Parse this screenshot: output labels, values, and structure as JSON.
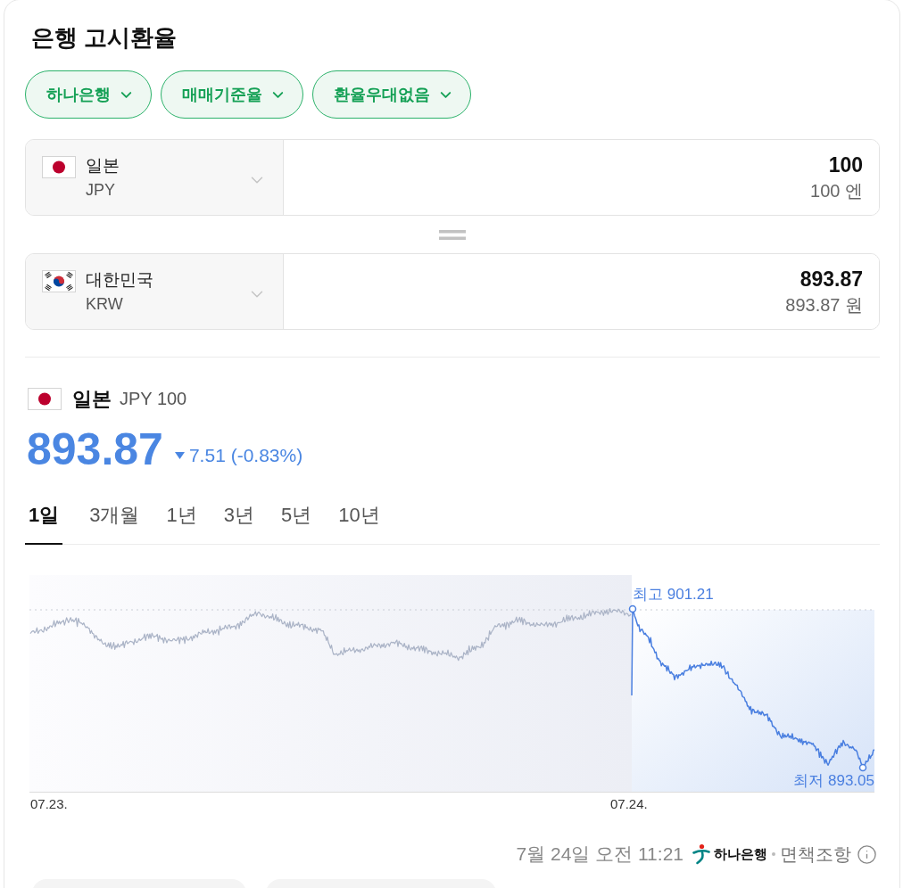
{
  "title": "은행 고시환율",
  "filters": [
    {
      "label": "하나은행"
    },
    {
      "label": "매매기준율"
    },
    {
      "label": "환율우대없음"
    }
  ],
  "converter": {
    "rows": [
      {
        "kind": "jp",
        "country": "일본",
        "code": "JPY",
        "amount": "100",
        "amount_text": "100 엔"
      },
      {
        "kind": "kr",
        "country": "대한민국",
        "code": "KRW",
        "amount": "893.87",
        "amount_text": "893.87 원"
      }
    ]
  },
  "quote": {
    "country": "일본",
    "unit": "JPY 100",
    "price": "893.87",
    "falling": true,
    "change": "7.51 (-0.83%)"
  },
  "periods": [
    {
      "label": "1일",
      "selected": true
    },
    {
      "label": "3개월",
      "selected": false
    },
    {
      "label": "1년",
      "selected": false
    },
    {
      "label": "3년",
      "selected": false
    },
    {
      "label": "5년",
      "selected": false
    },
    {
      "label": "10년",
      "selected": false
    }
  ],
  "chart": {
    "high_label": "최고 901.21",
    "low_label": "최저 893.05",
    "x_labels": [
      "07.23.",
      "07.24."
    ]
  },
  "footer": {
    "timestamp": "7월 24일 오전 11:21",
    "source": "하나은행",
    "disclaimer": "면책조항"
  },
  "more_buttons": [
    {
      "kind": "chip"
    },
    {
      "kind": "chip"
    }
  ]
}
